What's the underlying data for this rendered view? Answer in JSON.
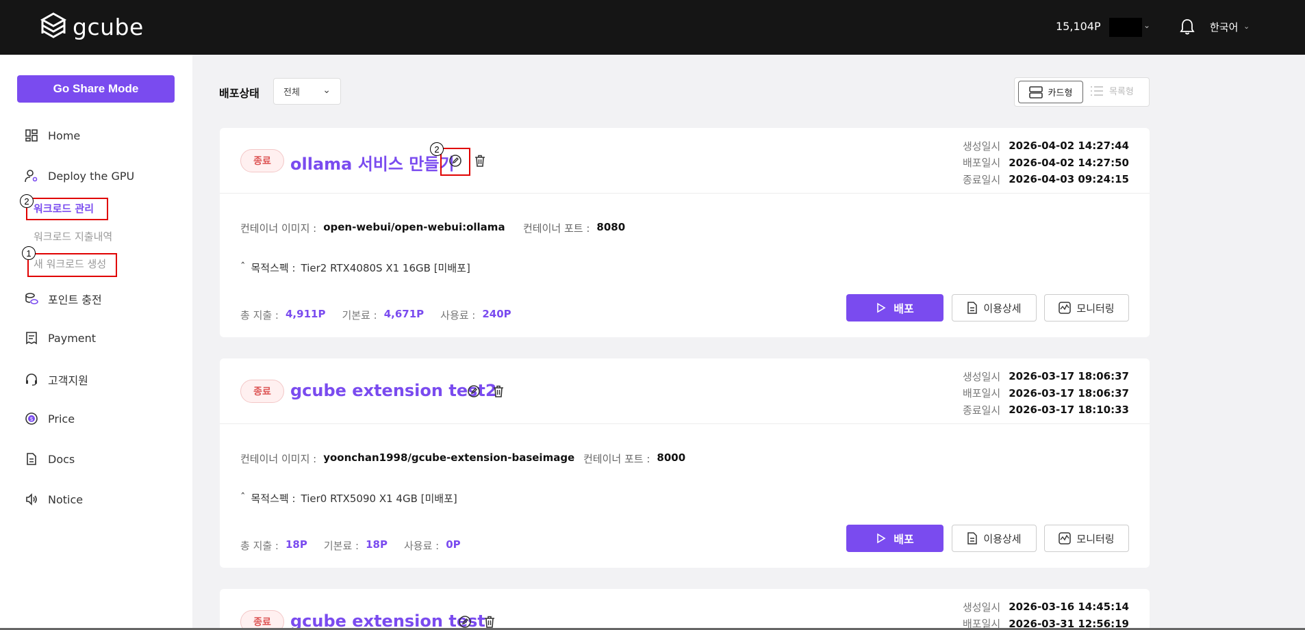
{
  "header": {
    "logo_text": "gcube",
    "points": "15,104P",
    "language": "한국어"
  },
  "sidebar": {
    "share_button": "Go Share Mode",
    "items": [
      {
        "label": "Home",
        "icon": "dashboard-icon"
      },
      {
        "label": "Deploy the GPU",
        "icon": "user-gear-icon"
      },
      {
        "label": "포인트 충전",
        "icon": "coins-icon"
      },
      {
        "label": "Payment",
        "icon": "receipt-icon"
      },
      {
        "label": "고객지원",
        "icon": "headset-icon"
      },
      {
        "label": "Price",
        "icon": "dollar-icon"
      },
      {
        "label": "Docs",
        "icon": "document-icon"
      },
      {
        "label": "Notice",
        "icon": "speaker-icon"
      }
    ],
    "sub_items": [
      {
        "label": "워크로드 관리"
      },
      {
        "label": "워크로드 지출내역"
      },
      {
        "label": "새 워크로드 생성"
      }
    ]
  },
  "annotations": {
    "one": "1",
    "two": "2"
  },
  "filter": {
    "label": "배포상태",
    "selected": "전체"
  },
  "view_toggle": {
    "card": "카드형",
    "list": "목록형"
  },
  "labels": {
    "created": "생성일시",
    "deployed": "배포일시",
    "ended": "종료일시",
    "image": "컨테이너 이미지 :",
    "port": "컨테이너 포트 :",
    "spec": "목적스펙 :",
    "total": "총 지출 :",
    "base": "기본료 :",
    "usage": "사용료 :",
    "deploy_btn": "배포",
    "detail_btn": "이용상세",
    "monitor_btn": "모니터링"
  },
  "cards": [
    {
      "status": "종료",
      "title": "ollama 서비스 만들기",
      "created": "2026-04-02 14:27:44",
      "deployed": "2026-04-02 14:27:50",
      "ended": "2026-04-03 09:24:15",
      "image": "open-webui/open-webui:ollama",
      "port": "8080",
      "spec": "Tier2 RTX4080S X1 16GB [미배포]",
      "total": "4,911P",
      "base": "4,671P",
      "usage": "240P"
    },
    {
      "status": "종료",
      "title": "gcube extension test2",
      "created": "2026-03-17 18:06:37",
      "deployed": "2026-03-17 18:06:37",
      "ended": "2026-03-17 18:10:33",
      "image": "yoonchan1998/gcube-extension-baseimage",
      "port": "8000",
      "spec": "Tier0 RTX5090 X1 4GB [미배포]",
      "total": "18P",
      "base": "18P",
      "usage": "0P"
    },
    {
      "status": "종료",
      "title": "gcube extension test",
      "created": "2026-03-16 14:45:14",
      "deployed": "2026-03-31 12:56:19"
    }
  ]
}
